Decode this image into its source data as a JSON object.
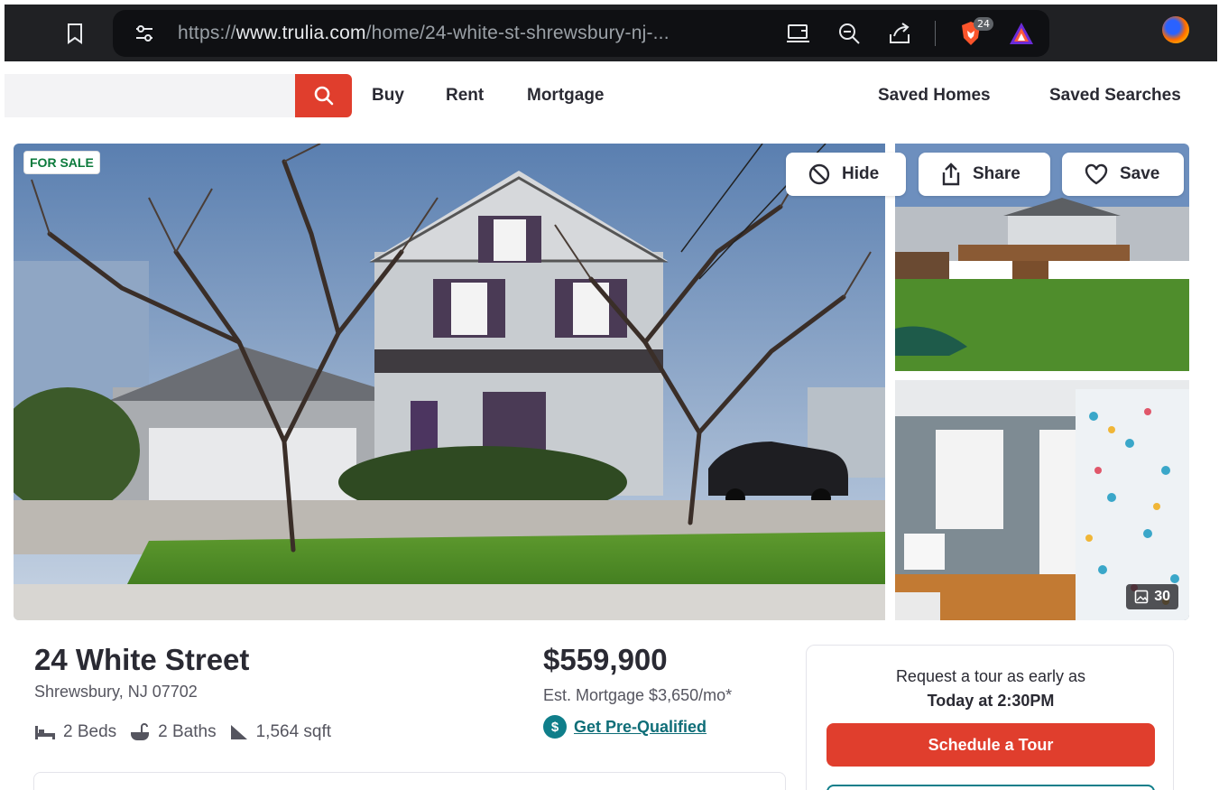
{
  "browser": {
    "url_scheme": "https://",
    "url_domain": "www.trulia.com",
    "url_path": "/home/24-white-st-shrewsbury-nj-...",
    "shields_badge": "24"
  },
  "nav": {
    "links": [
      "Buy",
      "Rent",
      "Mortgage"
    ],
    "right_links": [
      "Saved Homes",
      "Saved Searches"
    ]
  },
  "gallery": {
    "status_label": "FOR SALE",
    "hide_label": "Hide",
    "share_label": "Share",
    "save_label": "Save",
    "photo_count": "30"
  },
  "listing": {
    "address": "24 White Street",
    "city": "Shrewsbury, NJ 07702",
    "beds": "2 Beds",
    "baths": "2 Baths",
    "sqft": "1,564 sqft",
    "price": "$559,900",
    "est_mortgage": "Est. Mortgage $3,650/mo*",
    "prequal_label": "Get Pre-Qualified"
  },
  "tour": {
    "line1": "Request a tour as early as",
    "line2": "Today at 2:30PM",
    "button_label": "Schedule a Tour"
  },
  "colors": {
    "brand_red": "#e03e2d",
    "teal": "#0f7e8a",
    "status_green": "#0b7a3b"
  }
}
